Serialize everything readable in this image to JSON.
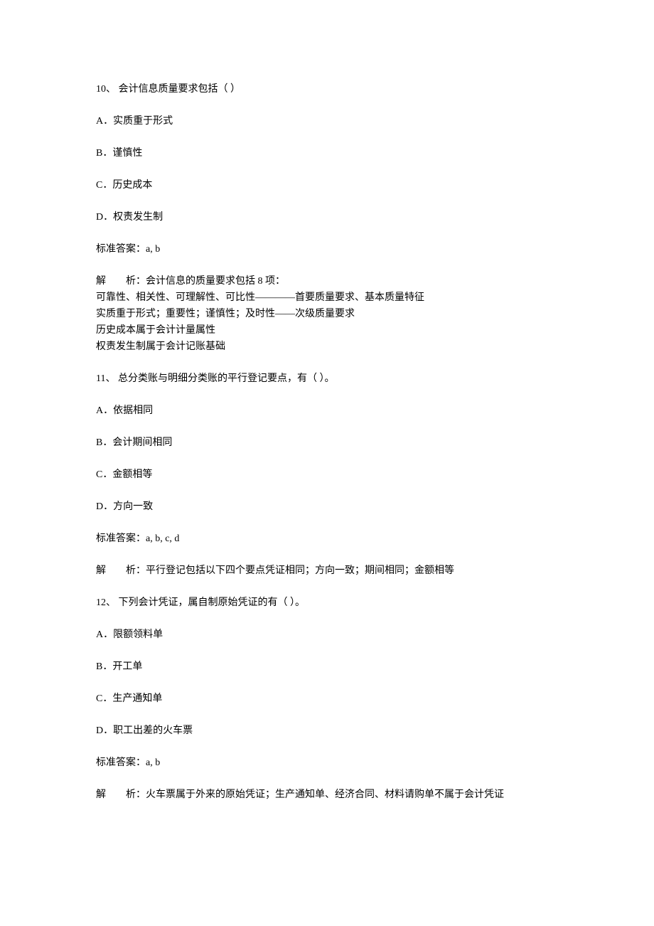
{
  "q10": {
    "stem": "10、 会计信息质量要求包括（ ）",
    "optA": "A．实质重于形式",
    "optB": "B．谨慎性",
    "optC": "C．历史成本",
    "optD": "D．权责发生制",
    "answer": "标准答案：a, b",
    "explainLabel": "解",
    "explainCont": "析：会计信息的质量要求包括 8 项：",
    "line1": "可靠性、相关性、可理解性、可比性————首要质量要求、基本质量特征",
    "line2": "实质重于形式；重要性；谨慎性；及时性——次级质量要求",
    "line3": "历史成本属于会计计量属性",
    "line4": "权责发生制属于会计记账基础"
  },
  "q11": {
    "stem": "11、 总分类账与明细分类账的平行登记要点，有（ ）。",
    "optA": "A．依据相同",
    "optB": "B．会计期间相同",
    "optC": "C．金额相等",
    "optD": "D．方向一致",
    "answer": "标准答案：a, b, c, d",
    "explainLabel": "解",
    "explainCont": "析：平行登记包括以下四个要点凭证相同；方向一致；期间相同；金额相等"
  },
  "q12": {
    "stem": "12、 下列会计凭证，属自制原始凭证的有（  ）。",
    "optA": "A．限额领料单",
    "optB": "B．开工单",
    "optC": "C．生产通知单",
    "optD": "D．职工出差的火车票",
    "answer": "标准答案：a, b",
    "explainLabel": "解",
    "explainCont": "析：火车票属于外来的原始凭证；生产通知单、经济合同、材料请购单不属于会计凭证"
  }
}
